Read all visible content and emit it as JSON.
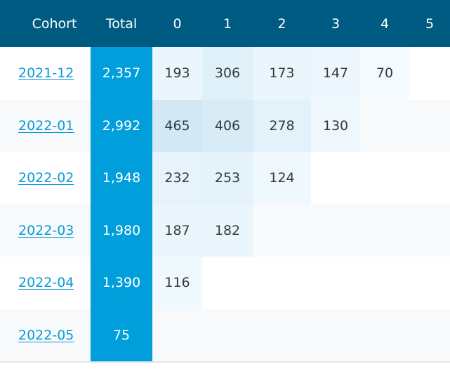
{
  "headers": [
    "Cohort",
    "Total",
    "0",
    "1",
    "2",
    "3",
    "4",
    "5"
  ],
  "rows": [
    {
      "cohort": "2021-12",
      "total": "2,357",
      "cells": [
        "193",
        "306",
        "173",
        "147",
        "70",
        ""
      ]
    },
    {
      "cohort": "2022-01",
      "total": "2,992",
      "cells": [
        "465",
        "406",
        "278",
        "130",
        "",
        ""
      ]
    },
    {
      "cohort": "2022-02",
      "total": "1,948",
      "cells": [
        "232",
        "253",
        "124",
        "",
        "",
        ""
      ]
    },
    {
      "cohort": "2022-03",
      "total": "1,980",
      "cells": [
        "187",
        "182",
        "",
        "",
        "",
        ""
      ]
    },
    {
      "cohort": "2022-04",
      "total": "1,390",
      "cells": [
        "116",
        "",
        "",
        "",
        "",
        ""
      ]
    },
    {
      "cohort": "2022-05",
      "total": "75",
      "cells": [
        "",
        "",
        "",
        "",
        "",
        ""
      ]
    }
  ],
  "colors": {
    "header_bg": "#005b82",
    "total_bg": "#009edb",
    "link": "#0a9bd6",
    "heat_max": "#d2e9f5",
    "heat_min": "#f5fbff"
  }
}
